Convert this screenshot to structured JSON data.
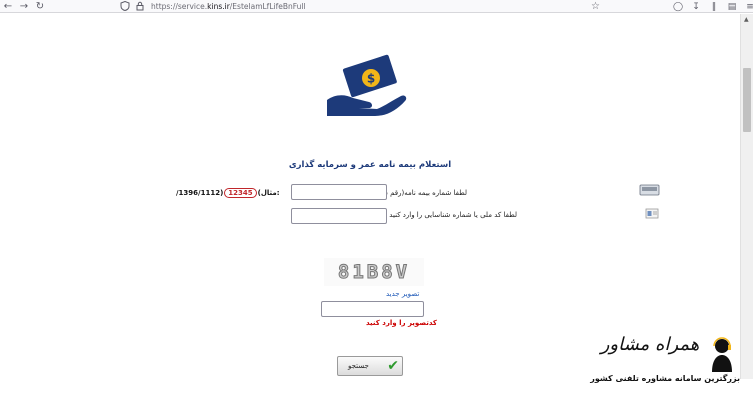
{
  "browser": {
    "url_prefix": "https://service.",
    "url_domain": "kins.ir",
    "url_path": "/EstelamLfLifeBnFull"
  },
  "page": {
    "title": "استعلام بیمه نامه عمر و سرمایه گذاری",
    "policy_label": "لطفا شماره بیمه نامه(رقم سمت راست) را وارد کنید",
    "policy_value": "",
    "example_prefix": "(مثال:",
    "example_highlight": "12345",
    "example_suffix": "/1396/1112)",
    "national_label": "لطفا کد ملی یا شماره شناسایی را وارد کنید",
    "national_value": "",
    "captcha_text": "81B8V",
    "new_image_link": "تصویر جدید",
    "captcha_value": "",
    "captcha_error": "کدتصویر را وارد کنید",
    "search_button": "جستجو"
  },
  "watermark": {
    "title": "همراه مشاور",
    "subtitle": "بزرگترین سامانه مشاوره تلفنی کشور"
  },
  "colors": {
    "title": "#1d3a7a",
    "logo": "#1d3a7a",
    "coin": "#f2b619",
    "error": "#cc0000",
    "link": "#1a56b7",
    "highlight": "#c0262b"
  }
}
